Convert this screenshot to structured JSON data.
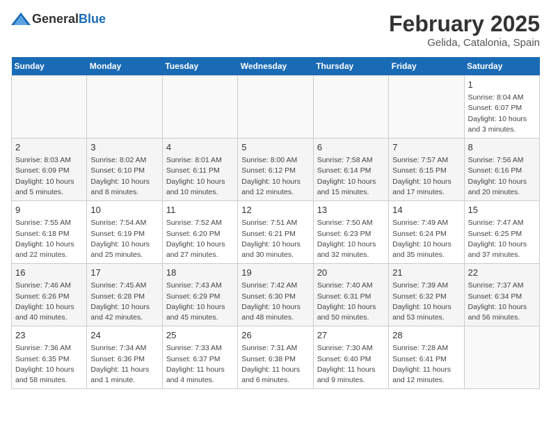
{
  "header": {
    "logo_general": "General",
    "logo_blue": "Blue",
    "month": "February 2025",
    "location": "Gelida, Catalonia, Spain"
  },
  "days_of_week": [
    "Sunday",
    "Monday",
    "Tuesday",
    "Wednesday",
    "Thursday",
    "Friday",
    "Saturday"
  ],
  "weeks": [
    [
      {
        "day": "",
        "info": ""
      },
      {
        "day": "",
        "info": ""
      },
      {
        "day": "",
        "info": ""
      },
      {
        "day": "",
        "info": ""
      },
      {
        "day": "",
        "info": ""
      },
      {
        "day": "",
        "info": ""
      },
      {
        "day": "1",
        "info": "Sunrise: 8:04 AM\nSunset: 6:07 PM\nDaylight: 10 hours and 3 minutes."
      }
    ],
    [
      {
        "day": "2",
        "info": "Sunrise: 8:03 AM\nSunset: 6:09 PM\nDaylight: 10 hours and 5 minutes."
      },
      {
        "day": "3",
        "info": "Sunrise: 8:02 AM\nSunset: 6:10 PM\nDaylight: 10 hours and 8 minutes."
      },
      {
        "day": "4",
        "info": "Sunrise: 8:01 AM\nSunset: 6:11 PM\nDaylight: 10 hours and 10 minutes."
      },
      {
        "day": "5",
        "info": "Sunrise: 8:00 AM\nSunset: 6:12 PM\nDaylight: 10 hours and 12 minutes."
      },
      {
        "day": "6",
        "info": "Sunrise: 7:58 AM\nSunset: 6:14 PM\nDaylight: 10 hours and 15 minutes."
      },
      {
        "day": "7",
        "info": "Sunrise: 7:57 AM\nSunset: 6:15 PM\nDaylight: 10 hours and 17 minutes."
      },
      {
        "day": "8",
        "info": "Sunrise: 7:56 AM\nSunset: 6:16 PM\nDaylight: 10 hours and 20 minutes."
      }
    ],
    [
      {
        "day": "9",
        "info": "Sunrise: 7:55 AM\nSunset: 6:18 PM\nDaylight: 10 hours and 22 minutes."
      },
      {
        "day": "10",
        "info": "Sunrise: 7:54 AM\nSunset: 6:19 PM\nDaylight: 10 hours and 25 minutes."
      },
      {
        "day": "11",
        "info": "Sunrise: 7:52 AM\nSunset: 6:20 PM\nDaylight: 10 hours and 27 minutes."
      },
      {
        "day": "12",
        "info": "Sunrise: 7:51 AM\nSunset: 6:21 PM\nDaylight: 10 hours and 30 minutes."
      },
      {
        "day": "13",
        "info": "Sunrise: 7:50 AM\nSunset: 6:23 PM\nDaylight: 10 hours and 32 minutes."
      },
      {
        "day": "14",
        "info": "Sunrise: 7:49 AM\nSunset: 6:24 PM\nDaylight: 10 hours and 35 minutes."
      },
      {
        "day": "15",
        "info": "Sunrise: 7:47 AM\nSunset: 6:25 PM\nDaylight: 10 hours and 37 minutes."
      }
    ],
    [
      {
        "day": "16",
        "info": "Sunrise: 7:46 AM\nSunset: 6:26 PM\nDaylight: 10 hours and 40 minutes."
      },
      {
        "day": "17",
        "info": "Sunrise: 7:45 AM\nSunset: 6:28 PM\nDaylight: 10 hours and 42 minutes."
      },
      {
        "day": "18",
        "info": "Sunrise: 7:43 AM\nSunset: 6:29 PM\nDaylight: 10 hours and 45 minutes."
      },
      {
        "day": "19",
        "info": "Sunrise: 7:42 AM\nSunset: 6:30 PM\nDaylight: 10 hours and 48 minutes."
      },
      {
        "day": "20",
        "info": "Sunrise: 7:40 AM\nSunset: 6:31 PM\nDaylight: 10 hours and 50 minutes."
      },
      {
        "day": "21",
        "info": "Sunrise: 7:39 AM\nSunset: 6:32 PM\nDaylight: 10 hours and 53 minutes."
      },
      {
        "day": "22",
        "info": "Sunrise: 7:37 AM\nSunset: 6:34 PM\nDaylight: 10 hours and 56 minutes."
      }
    ],
    [
      {
        "day": "23",
        "info": "Sunrise: 7:36 AM\nSunset: 6:35 PM\nDaylight: 10 hours and 58 minutes."
      },
      {
        "day": "24",
        "info": "Sunrise: 7:34 AM\nSunset: 6:36 PM\nDaylight: 11 hours and 1 minute."
      },
      {
        "day": "25",
        "info": "Sunrise: 7:33 AM\nSunset: 6:37 PM\nDaylight: 11 hours and 4 minutes."
      },
      {
        "day": "26",
        "info": "Sunrise: 7:31 AM\nSunset: 6:38 PM\nDaylight: 11 hours and 6 minutes."
      },
      {
        "day": "27",
        "info": "Sunrise: 7:30 AM\nSunset: 6:40 PM\nDaylight: 11 hours and 9 minutes."
      },
      {
        "day": "28",
        "info": "Sunrise: 7:28 AM\nSunset: 6:41 PM\nDaylight: 11 hours and 12 minutes."
      },
      {
        "day": "",
        "info": ""
      }
    ]
  ]
}
